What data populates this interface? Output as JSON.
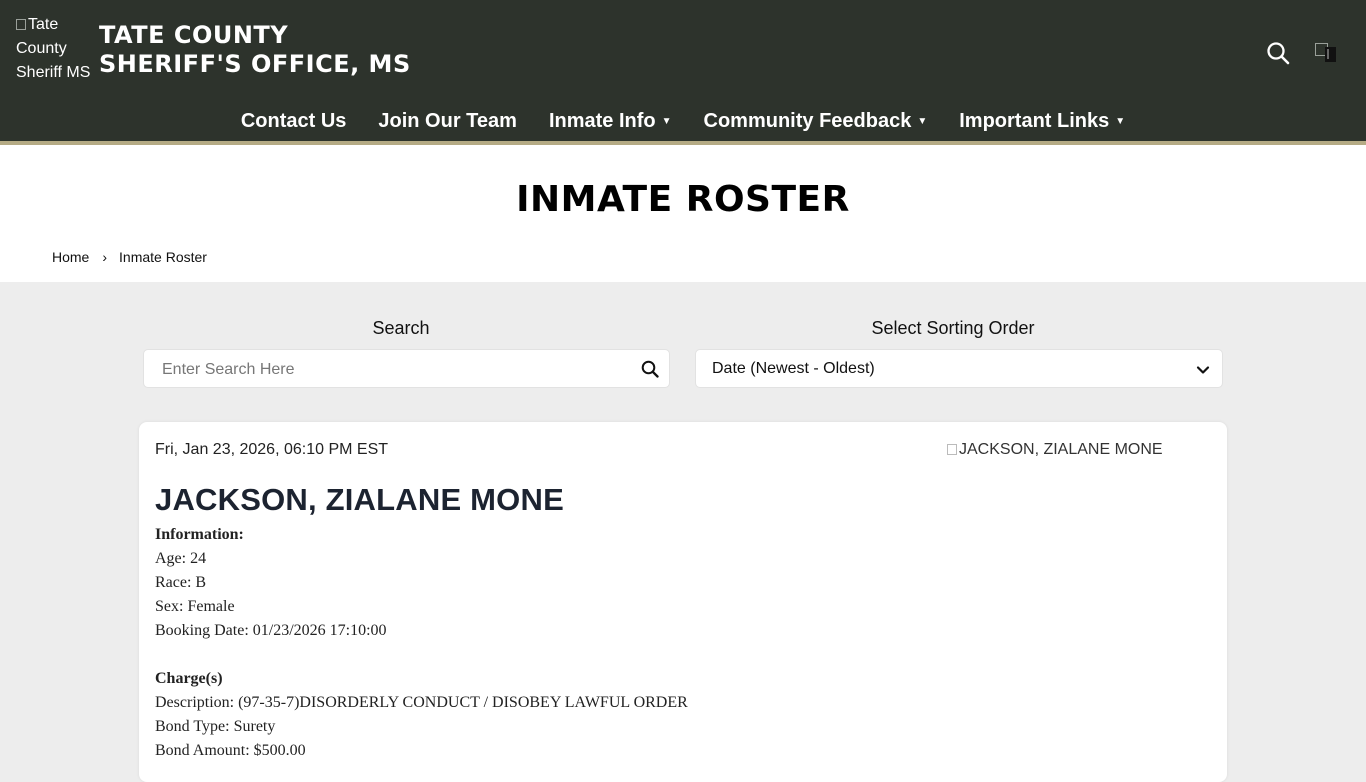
{
  "header": {
    "logo_alt": "Tate County Sheriff MS",
    "title_line1": "TATE COUNTY",
    "title_line2": "SHERIFF'S OFFICE, MS",
    "icons": [
      "search-icon",
      "broken-image-icon"
    ],
    "colors": {
      "background": "#2d332c",
      "accent_border": "#b5ab85"
    }
  },
  "nav": {
    "items": [
      {
        "label": "Contact Us",
        "dropdown": false
      },
      {
        "label": "Join Our Team",
        "dropdown": false
      },
      {
        "label": "Inmate Info",
        "dropdown": true
      },
      {
        "label": "Community Feedback",
        "dropdown": true
      },
      {
        "label": "Important Links",
        "dropdown": true
      }
    ]
  },
  "page": {
    "title": "INMATE ROSTER",
    "breadcrumb": {
      "home": "Home",
      "separator": "›",
      "current": "Inmate Roster"
    }
  },
  "search": {
    "label": "Search",
    "placeholder": "Enter Search Here",
    "value": ""
  },
  "sort": {
    "label": "Select Sorting Order",
    "selected": "Date (Newest - Oldest)"
  },
  "inmate": {
    "date": "Fri, Jan 23, 2026, 06:10 PM EST",
    "image_alt": "JACKSON, ZIALANE MONE",
    "name": "JACKSON, ZIALANE MONE",
    "information_heading": "Information:",
    "age": "Age: 24",
    "race": "Race: B",
    "sex": "Sex: Female",
    "booking_date": "Booking Date: 01/23/2026 17:10:00",
    "charges_heading": "Charge(s)",
    "description": "Description: (97-35-7)DISORDERLY CONDUCT / DISOBEY LAWFUL ORDER",
    "bond_type": "Bond Type: Surety",
    "bond_amount": "Bond Amount: $500.00"
  }
}
